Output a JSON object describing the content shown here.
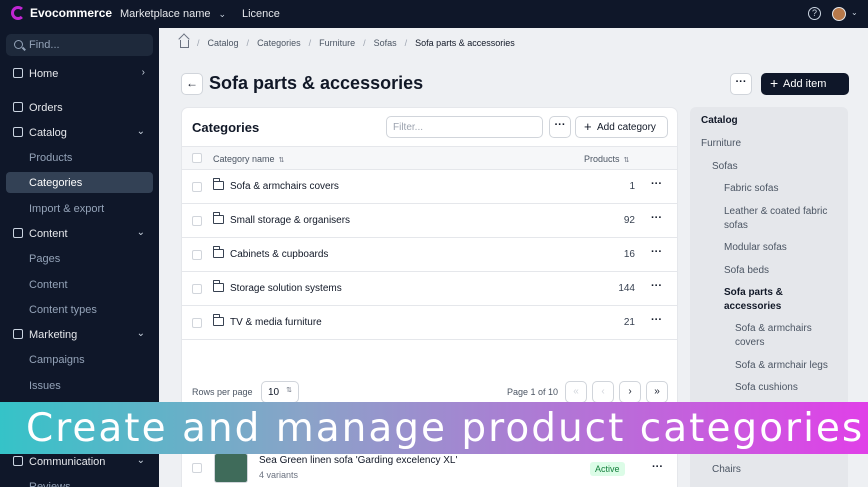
{
  "app": {
    "name": "Evocommerce",
    "marketplace": "Marketplace name",
    "licence": "Licence",
    "help_glyph": "?"
  },
  "sidebar": {
    "search_placeholder": "Find...",
    "home": "Home",
    "orders": "Orders",
    "catalog": "Catalog",
    "catalog_items": [
      "Products",
      "Categories",
      "Import & export"
    ],
    "content": "Content",
    "content_items": [
      "Pages",
      "Content",
      "Content types"
    ],
    "marketing": "Marketing",
    "marketing_items": [
      "Campaigns",
      "Issues"
    ],
    "communication": "Communication",
    "reviews": "Reviews"
  },
  "breadcrumb": [
    "Catalog",
    "Categories",
    "Furniture",
    "Sofas",
    "Sofa parts & accessories"
  ],
  "page": {
    "title": "Sofa parts & accessories",
    "add_item": "Add item",
    "more": "···",
    "back": "←"
  },
  "categories": {
    "title": "Categories",
    "filter_placeholder": "Filter...",
    "add_category": "Add category",
    "col_name": "Category name",
    "col_products": "Products",
    "rows": [
      {
        "name": "Sofa & armchairs covers",
        "count": "1"
      },
      {
        "name": "Small storage & organisers",
        "count": "92"
      },
      {
        "name": "Cabinets & cupboards",
        "count": "16"
      },
      {
        "name": "Storage solution systems",
        "count": "144"
      },
      {
        "name": "TV & media furniture",
        "count": "21"
      }
    ],
    "rows_per_page_label": "Rows per page",
    "rows_per_page": "10",
    "page_label": "Page 1 of 10"
  },
  "products": {
    "name": "Sea Green linen sofa 'Garding excelency XL'",
    "variants": "4 variants",
    "status": "Active"
  },
  "tree": {
    "root": "Catalog",
    "items": [
      {
        "label": "Furniture",
        "level": 1
      },
      {
        "label": "Sofas",
        "level": 2
      },
      {
        "label": "Fabric sofas",
        "level": 3
      },
      {
        "label": "Leather & coated fabric sofas",
        "level": 3
      },
      {
        "label": "Modular sofas",
        "level": 3
      },
      {
        "label": "Sofa beds",
        "level": 3
      },
      {
        "label": "Sofa parts & accessories",
        "level": 3,
        "active": true
      },
      {
        "label": "Sofa & armchairs covers",
        "level": 4
      },
      {
        "label": "Sofa & armchair legs",
        "level": 4
      },
      {
        "label": "Sofa cushions",
        "level": 4
      },
      {
        "label": "Chairs",
        "level": 2
      }
    ]
  },
  "banner": {
    "text": "Create and manage product categories"
  },
  "colors": {
    "sidebar": "#0f1729",
    "accent": "#c026d3",
    "active_badge": "#dcfce7"
  }
}
